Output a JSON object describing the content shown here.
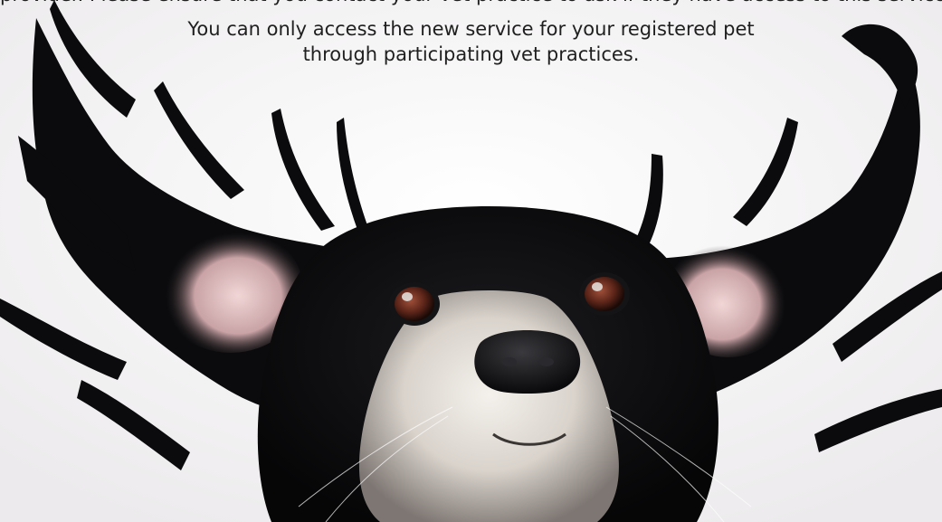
{
  "hero": {
    "image_subject": "black-and-white-dog-with-ears-flying",
    "colors": {
      "background": "#f4f2f4",
      "fur": "#0c0c0e",
      "muzzle": "#e8e4df",
      "ear_inner": "#e9c9c9",
      "eye": "#5a2418",
      "nose": "#141416",
      "text": "#1f1f1f"
    }
  },
  "caption": {
    "clipped_line": "provider. Please ensure that you contact your vet practice to ask if they have access to this service.",
    "line1": "You can only access the new service for your registered pet",
    "line2": "through participating vet practices."
  }
}
